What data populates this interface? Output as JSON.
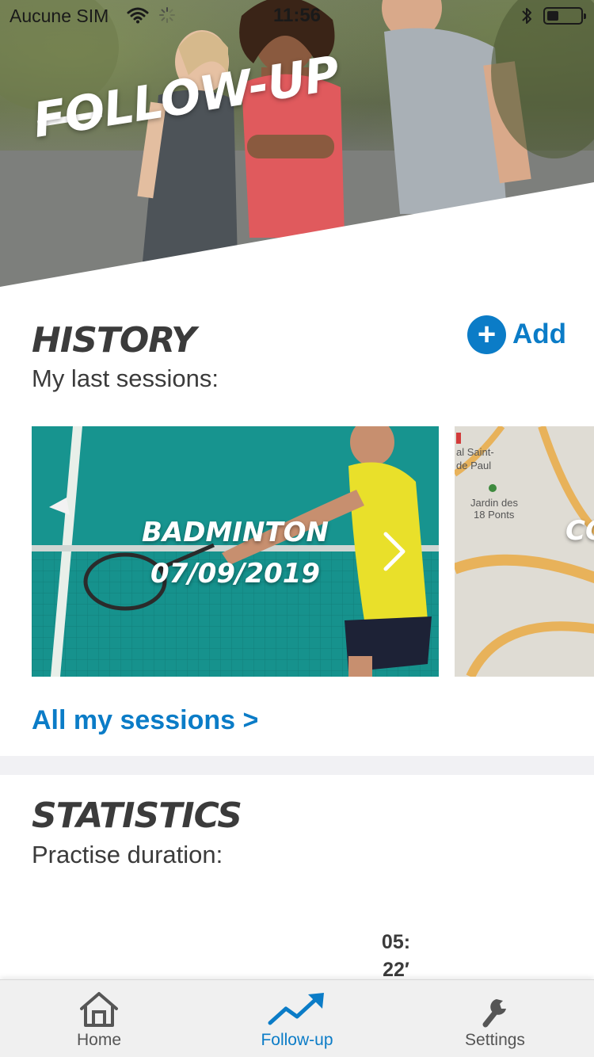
{
  "status_bar": {
    "carrier": "Aucune SIM",
    "time": "11:56",
    "battery_level": 0.35
  },
  "hero": {
    "title": "FOLLOW-UP"
  },
  "history": {
    "title": "HISTORY",
    "subtitle": "My last sessions:",
    "add_label": "Add",
    "cards": [
      {
        "sport": "BADMINTON",
        "date": "07/09/2019"
      },
      {
        "sport": "CO",
        "map_labels": [
          "al Saint-",
          "de Paul",
          "Jardin des",
          "18 Ponts"
        ]
      }
    ],
    "all_sessions_label": "All my sessions >"
  },
  "statistics": {
    "title": "STATISTICS",
    "subtitle": "Practise duration:",
    "value_line1": "05:",
    "value_line2": "22′"
  },
  "tabbar": {
    "tabs": [
      {
        "label": "Home",
        "icon": "home-icon"
      },
      {
        "label": "Follow-up",
        "icon": "trend-up-icon",
        "active": true
      },
      {
        "label": "Settings",
        "icon": "wrench-icon"
      }
    ]
  },
  "colors": {
    "accent": "#0b7cc7",
    "divider": "#f1f1f4",
    "tabbar": "#f0f0f0"
  }
}
